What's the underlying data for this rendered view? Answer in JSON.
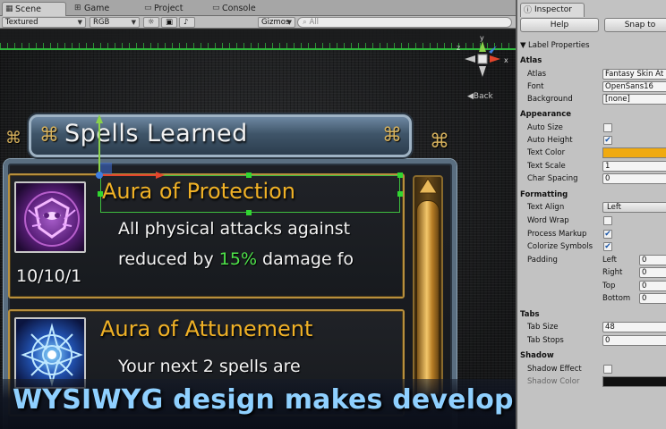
{
  "tabs": [
    {
      "label": "Scene",
      "icon": "scene-icon"
    },
    {
      "label": "Game",
      "icon": "game-icon"
    },
    {
      "label": "Project",
      "icon": "project-icon"
    },
    {
      "label": "Console",
      "icon": "console-icon"
    }
  ],
  "toolbar": {
    "draw_mode": "Textured",
    "render_mode": "RGB",
    "gizmos_label": "Gizmos",
    "search_placeholder": "All"
  },
  "scene": {
    "back_label": "Back",
    "gizmo_axes": [
      "y",
      "x",
      "z"
    ],
    "window_title": "Spells Learned",
    "spells": [
      {
        "name": "Aura of Protection",
        "desc_line1": "All physical attacks against",
        "desc_line2_pre": "reduced by ",
        "desc_line2_highlight": "15%",
        "desc_line2_post": " damage fo",
        "date": "10/10/1"
      },
      {
        "name": "Aura of Attunement",
        "desc_line1": "Your next 2 spells are"
      }
    ]
  },
  "banner": {
    "text": "WYSIWYG design makes developing your UI easy"
  },
  "inspector": {
    "tab_label": "Inspector",
    "help_button": "Help",
    "snap_button": "Snap to",
    "component_title": "Label Properties",
    "sections": {
      "atlas": "Atlas",
      "appearance": "Appearance",
      "formatting": "Formatting",
      "tabs": "Tabs",
      "shadow": "Shadow"
    },
    "fields": {
      "atlas_label": "Atlas",
      "atlas_value": "Fantasy Skin At",
      "font_label": "Font",
      "font_value": "OpenSans16",
      "background_label": "Background",
      "background_value": "[none]",
      "auto_size_label": "Auto Size",
      "auto_size": false,
      "auto_height_label": "Auto Height",
      "auto_height": true,
      "text_color_label": "Text Color",
      "text_color": "#f0aa10",
      "text_scale_label": "Text Scale",
      "text_scale_value": "1",
      "char_spacing_label": "Char Spacing",
      "char_spacing_value": "0",
      "text_align_label": "Text Align",
      "text_align_value": "Left",
      "word_wrap_label": "Word Wrap",
      "word_wrap": false,
      "process_markup_label": "Process Markup",
      "process_markup": true,
      "colorize_symbols_label": "Colorize Symbols",
      "colorize_symbols": true,
      "padding_label": "Padding",
      "padding_left_label": "Left",
      "padding_left": "0",
      "padding_right_label": "Right",
      "padding_right": "0",
      "padding_top_label": "Top",
      "padding_top": "0",
      "padding_bottom_label": "Bottom",
      "padding_bottom": "0",
      "tab_size_label": "Tab Size",
      "tab_size_value": "48",
      "tab_stops_label": "Tab Stops",
      "tab_stops_value": "0",
      "shadow_effect_label": "Shadow Effect",
      "shadow_effect": false,
      "shadow_color_label": "Shadow Color"
    }
  },
  "colors": {
    "accent_gold": "#f0b126",
    "highlight_green": "#4ee24a",
    "banner_text": "#8fd0ff",
    "selection_green": "#31d631"
  }
}
